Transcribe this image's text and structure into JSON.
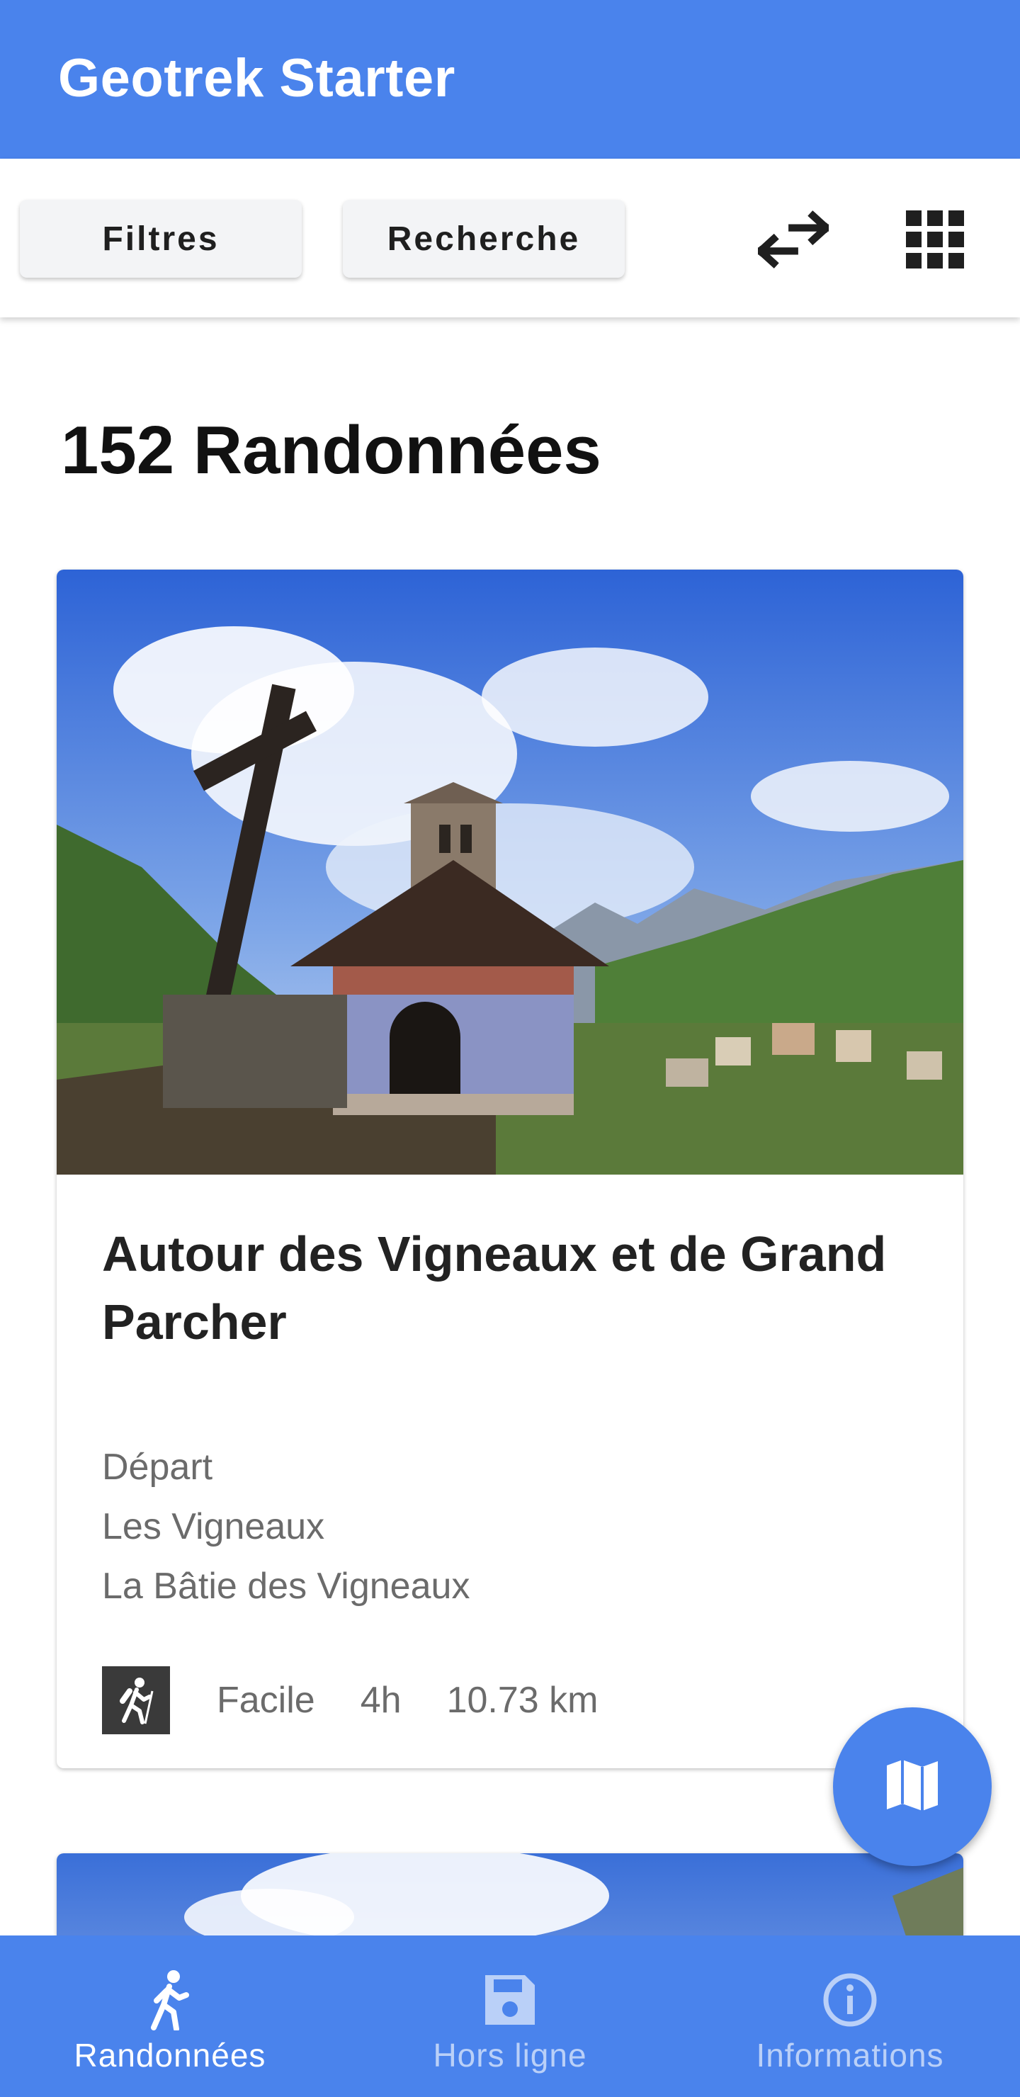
{
  "app": {
    "title": "Geotrek Starter"
  },
  "toolbar": {
    "filters_label": "Filtres",
    "search_label": "Recherche",
    "swap_icon": "swap-arrows-icon",
    "grid_icon": "grid-icon"
  },
  "results": {
    "count_label": "152 Randonnées"
  },
  "card": {
    "title": "Autour des Vigneaux et de Grand Parcher",
    "depart_label": "Départ",
    "depart_place": "Les Vigneaux",
    "depart_town": "La Bâtie des Vigneaux",
    "practice_icon": "hiker-icon",
    "difficulty": "Facile",
    "duration": "4h",
    "distance": "10.73 km"
  },
  "fab": {
    "icon": "map-icon"
  },
  "bottom_nav": {
    "items": [
      {
        "label": "Randonnées",
        "icon": "walking-icon",
        "active": true
      },
      {
        "label": "Hors ligne",
        "icon": "save-icon",
        "active": false
      },
      {
        "label": "Informations",
        "icon": "info-icon",
        "active": false
      }
    ]
  },
  "colors": {
    "primary": "#4a83ec",
    "text_dark": "#222222",
    "text_muted": "#6b6b6b"
  }
}
